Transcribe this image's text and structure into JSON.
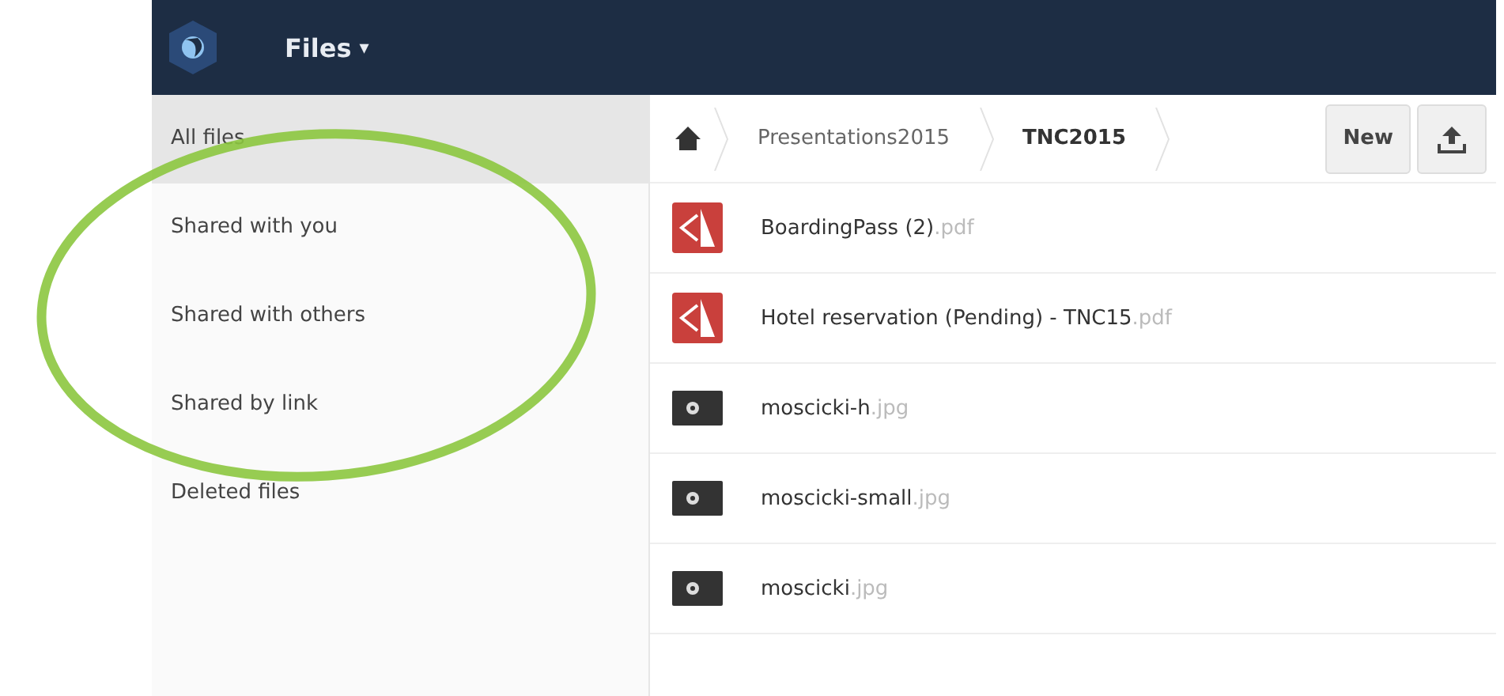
{
  "header": {
    "app_title": "Files",
    "caret": "▾"
  },
  "sidebar": {
    "items": [
      {
        "label": "All files",
        "selected": true
      },
      {
        "label": "Shared with you",
        "selected": false
      },
      {
        "label": "Shared with others",
        "selected": false
      },
      {
        "label": "Shared by link",
        "selected": false
      },
      {
        "label": "Deleted files",
        "selected": false
      }
    ]
  },
  "breadcrumb": [
    {
      "label": "Presentations2015",
      "selected": false
    },
    {
      "label": "TNC2015",
      "selected": true
    }
  ],
  "actions": {
    "new_button": "New"
  },
  "files": [
    {
      "name": "BoardingPass (2)",
      "extension": ".pdf",
      "kind": "pdf"
    },
    {
      "name": "Hotel reservation (Pending) - TNC15",
      "extension": ".pdf",
      "kind": "pdf"
    },
    {
      "name": "moscicki-h",
      "extension": ".jpg",
      "kind": "image"
    },
    {
      "name": "moscicki-small",
      "extension": ".jpg",
      "kind": "image"
    },
    {
      "name": "moscicki",
      "extension": ".jpg",
      "kind": "image"
    }
  ]
}
